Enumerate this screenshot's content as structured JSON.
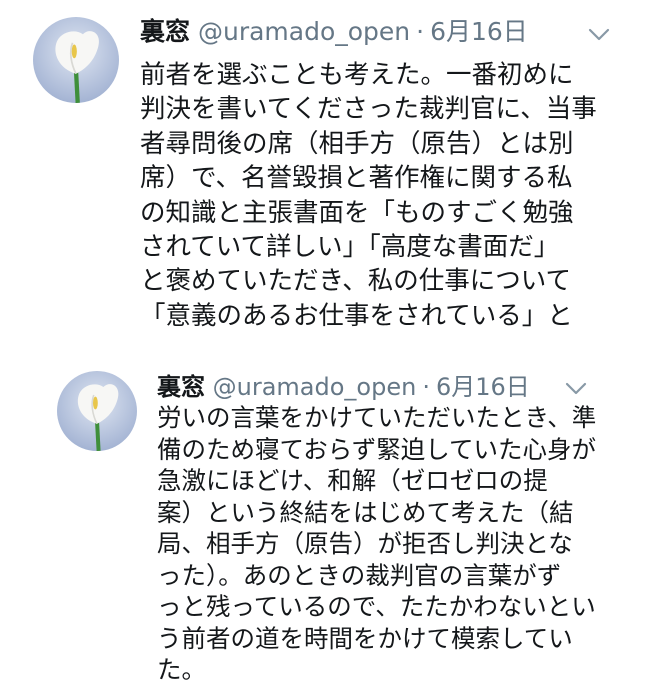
{
  "tweets": [
    {
      "name": "裏窓",
      "handle": "@uramado_open",
      "separator": "·",
      "date": "6月16日",
      "lines": [
        "前者を選ぶことも考えた。一番初めに",
        "判決を書いてくださった裁判官に、当事",
        "者尋問後の席（相手方（原告）とは別",
        "席）で、名誉毀損と著作権に関する私",
        "の知識と主張書面を「ものすごく勉強",
        "されていて詳しい」「高度な書面だ」",
        "と褒めていただき、私の仕事について",
        "「意義のあるお仕事をされている」と"
      ]
    },
    {
      "name": "裏窓",
      "handle": "@uramado_open",
      "separator": "·",
      "date": "6月16日",
      "lines": [
        "労いの言葉をかけていただいたとき、準",
        "備のため寝ておらず緊迫していた心身が",
        "急激にほどけ、和解（ゼロゼロの提",
        "案）という終結をはじめて考えた（結",
        "局、相手方（原告）が拒否し判決とな",
        "った）。あのときの裁判官の言葉がず",
        "っと残っているので、たたかわないとい",
        "う前者の道を時間をかけて模索してい",
        "た。"
      ]
    }
  ],
  "icons": {
    "avatar": "calla-lily-avatar-icon",
    "menu": "chevron-down-icon"
  },
  "colors": {
    "text": "#14171a",
    "secondary": "#657786",
    "background": "#ffffff"
  }
}
